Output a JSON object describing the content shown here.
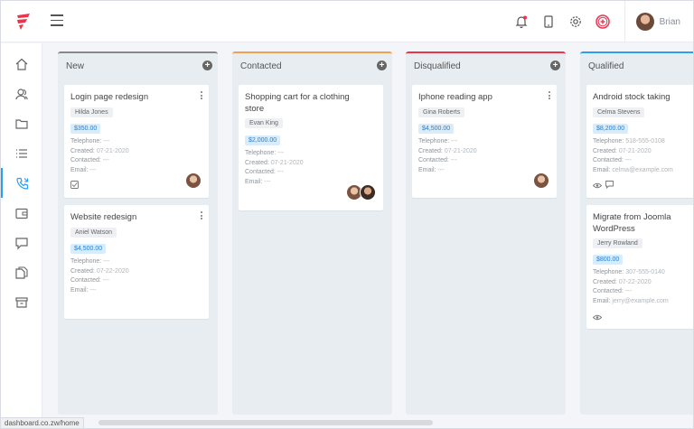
{
  "colors": {
    "accent": "#e8344d",
    "active": "#2a9df4",
    "new": "#888888",
    "contacted": "#f0a050",
    "disqualified": "#e8344d",
    "qualified": "#2a9df4"
  },
  "header": {
    "user_name": "Brian"
  },
  "sidebar": {
    "items": [
      "home-icon",
      "users-icon",
      "folder-icon",
      "list-icon",
      "phone-icon",
      "wallet-icon",
      "chat-icon",
      "documents-icon",
      "archive-icon"
    ]
  },
  "columns": [
    {
      "title": "New",
      "cards": [
        {
          "title": "Login page redesign",
          "owner": "Hilda Jones",
          "price": "$350.00",
          "telephone": "---",
          "created": "07-21-2020",
          "contacted": "---",
          "email": "---"
        },
        {
          "title": "Website redesign",
          "owner": "Aniel Watson",
          "price": "$4,500.00",
          "telephone": "---",
          "created": "07-22-2020",
          "contacted": "---",
          "email": "---"
        }
      ]
    },
    {
      "title": "Contacted",
      "cards": [
        {
          "title": "Shopping cart for a clothing store",
          "owner": "Evan King",
          "price": "$2,000.00",
          "telephone": "---",
          "created": "07-21-2020",
          "contacted": "---",
          "email": "---"
        }
      ]
    },
    {
      "title": "Disqualified",
      "cards": [
        {
          "title": "Iphone reading app",
          "owner": "Gina Roberts",
          "price": "$4,500.00",
          "telephone": "---",
          "created": "07-21-2020",
          "contacted": "---",
          "email": "---"
        }
      ]
    },
    {
      "title": "Qualified",
      "cards": [
        {
          "title": "Android stock taking",
          "owner": "Celma Stevens",
          "price": "$8,200.00",
          "telephone": "518-555-0108",
          "created": "07-21-2020",
          "contacted": "---",
          "email": "celma@example.com"
        },
        {
          "title": "Migrate from Joomla WordPress",
          "owner": "Jerry Rowland",
          "price": "$800.00",
          "telephone": "307-555-0140",
          "created": "07-22-2020",
          "contacted": "---",
          "email": "jerry@example.com"
        }
      ]
    }
  ],
  "labels": {
    "telephone": "Telephone:",
    "created": "Created:",
    "contacted": "Contacted:",
    "email": "Email:",
    "add": "+"
  },
  "statusbar": {
    "url": "dashboard.co.zw/home"
  }
}
